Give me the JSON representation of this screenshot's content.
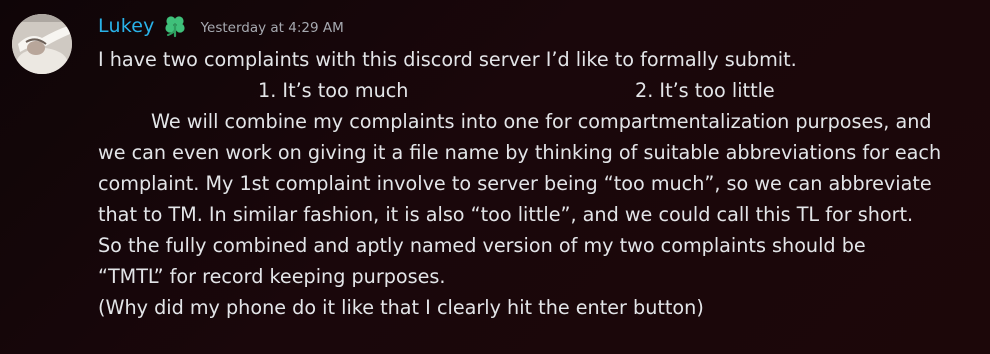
{
  "message": {
    "author": {
      "username": "Lukey",
      "role_icon": "clover-icon",
      "username_color": "#29b2e8"
    },
    "timestamp": "Yesterday at 4:29 AM",
    "lines": {
      "intro": "I have two complaints with this discord server I’d like to formally submit.",
      "item_1": "1. It’s too much",
      "item_2": "2. It’s too little",
      "p1": "We will combine my complaints into one for compartmentalization purposes, and",
      "p2": "we can even work on giving it a file name by thinking of suitable abbreviations for each",
      "p3": "complaint. My 1st complaint involve to server being “too much”, so we can abbreviate",
      "p4": "that to TM. In similar fashion, it is also “too little”, and we could call this TL for short.",
      "p5": "So the fully combined and aptly named version of my two complaints should be",
      "p6": "“TMTL” for record keeping purposes.",
      "p7": "(Why did my phone do it like that I clearly hit the enter button)"
    }
  },
  "colors": {
    "background": "#1a070b",
    "text": "#e3e5e8",
    "timestamp": "#a6a9b0",
    "role_icon": "#3fc07a"
  }
}
